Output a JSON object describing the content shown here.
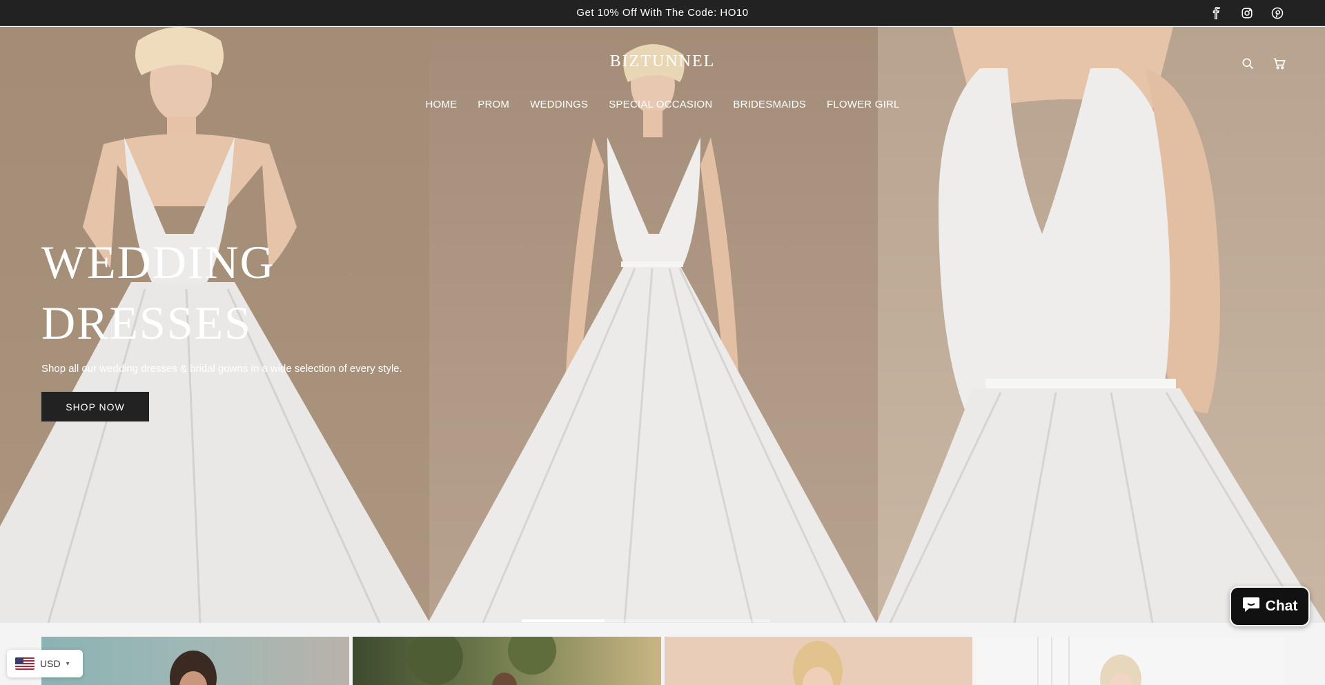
{
  "announcement": {
    "text": "Get 10% Off With The Code: HO10"
  },
  "social": [
    {
      "name": "facebook-icon"
    },
    {
      "name": "instagram-icon"
    },
    {
      "name": "pinterest-icon"
    }
  ],
  "header": {
    "logo": "BIZTUNNEL",
    "nav": [
      "HOME",
      "PROM",
      "WEDDINGS",
      "SPECIAL OCCASION",
      "BRIDESMAIDS",
      "FLOWER GIRL"
    ]
  },
  "hero": {
    "title_line1": "WEDDING",
    "title_line2": "DRESSES",
    "subtitle": "Shop all our wedding dresses & bridal gowns in a wide selection of every style.",
    "button": "SHOP NOW",
    "slides_total": 3,
    "active_slide": 1
  },
  "currency": {
    "code": "USD"
  },
  "chat": {
    "label": "Chat"
  },
  "colors": {
    "dark": "#222222",
    "white": "#ffffff"
  }
}
